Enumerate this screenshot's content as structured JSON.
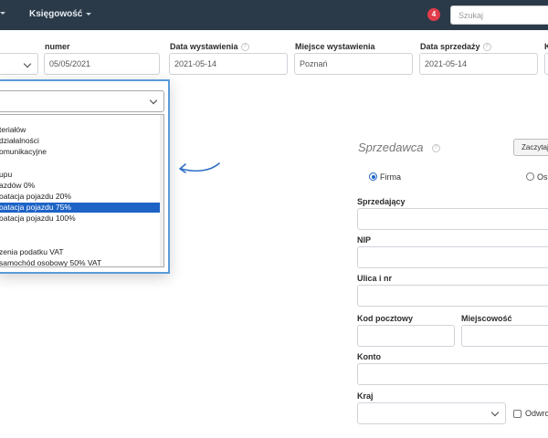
{
  "navbar": {
    "menu_label": "Księgowość",
    "notification_count": "4",
    "search_placeholder": "Szukaj"
  },
  "form": {
    "numer_label": "numer",
    "numer_value": "05/05/2021",
    "issue_date_label": "Data wystawienia",
    "issue_date_value": "2021-05-14",
    "issue_place_label": "Miejsce wystawienia",
    "issue_place_value": "Poznań",
    "sale_date_label": "Data sprzedaży",
    "sale_date_value": "2021-05-14",
    "partial_label": "K"
  },
  "dropdown": {
    "options": [
      "teriałów",
      "działalności",
      "omunikacyjne",
      "",
      "upu",
      "azdów 0%",
      "oatacja pojazdu 20%",
      "oatacja pojazdu 75%",
      "oatacja pojazdu 100%",
      "",
      "",
      "zenia podatku VAT",
      " samochód osobowy 50% VAT"
    ],
    "selected_index": 7
  },
  "seller": {
    "title": "Sprzedawca",
    "fetch_button": "Zaczytaj",
    "radio_company": "Firma",
    "radio_person": "Os",
    "seller_label": "Sprzedający",
    "nip_label": "NIP",
    "street_label": "Ulica i nr",
    "postal_label": "Kod pocztowy",
    "city_label": "Miejscowość",
    "account_label": "Konto",
    "country_label": "Kraj",
    "reverse_label": "Odwro"
  }
}
